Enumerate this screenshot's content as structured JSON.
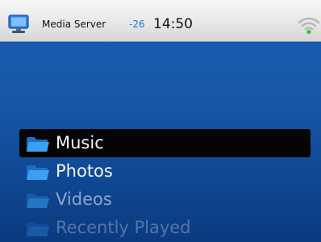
{
  "statusbar": {
    "app_title": "Media Server",
    "signal_value": "-26",
    "clock": "14:50",
    "icons": {
      "app": "monitor-icon",
      "wifi": "wifi-icon"
    },
    "colors": {
      "signal": "#1e78e0",
      "wifi_dot": "#3fbf3f"
    }
  },
  "menu": {
    "selected_index": 0,
    "items": [
      {
        "label": "Music",
        "icon": "folder-icon"
      },
      {
        "label": "Photos",
        "icon": "folder-icon"
      },
      {
        "label": "Videos",
        "icon": "folder-icon"
      },
      {
        "label": "Recently Played",
        "icon": "folder-icon"
      }
    ]
  },
  "colors": {
    "background": "#1a5fb4",
    "folder": "#2d8fe6",
    "highlight": "#050505"
  }
}
